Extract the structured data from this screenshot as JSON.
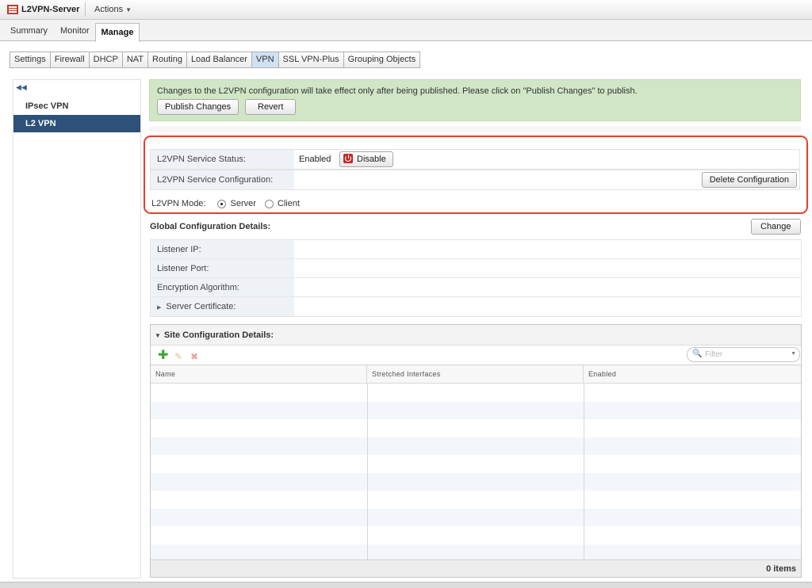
{
  "window": {
    "title": "L2VPN-Server",
    "actions_label": "Actions"
  },
  "main_tabs": {
    "summary": "Summary",
    "monitor": "Monitor",
    "manage": "Manage"
  },
  "sub_tabs": [
    "Settings",
    "Firewall",
    "DHCP",
    "NAT",
    "Routing",
    "Load Balancer",
    "VPN",
    "SSL VPN-Plus",
    "Grouping Objects"
  ],
  "sub_tabs_active": "VPN",
  "left_nav": {
    "items": [
      "IPsec VPN",
      "L2 VPN"
    ],
    "selected": "L2 VPN"
  },
  "notice": {
    "text": "Changes to the L2VPN configuration will take effect only after being published. Please click on \"Publish Changes\" to publish.",
    "publish_label": "Publish Changes",
    "revert_label": "Revert"
  },
  "service": {
    "status_label": "L2VPN Service Status:",
    "status_value": "Enabled",
    "disable_label": "Disable",
    "config_label": "L2VPN Service Configuration:",
    "delete_config_label": "Delete Configuration",
    "mode_label": "L2VPN Mode:",
    "mode_server": "Server",
    "mode_client": "Client",
    "mode_selected": "Server"
  },
  "global": {
    "header": "Global Configuration Details:",
    "change_label": "Change",
    "rows": [
      "Listener IP:",
      "Listener Port:",
      "Encryption Algorithm:",
      "Server Certificate:"
    ]
  },
  "site": {
    "header": "Site Configuration Details:",
    "filter_placeholder": "Filter",
    "columns": [
      "Name",
      "Stretched Interfaces",
      "Enabled"
    ],
    "items_count": "0 items"
  },
  "colors": {
    "accent": "#2d5179",
    "notice_bg": "#d1e6c5",
    "highlight": "#e0422d"
  }
}
